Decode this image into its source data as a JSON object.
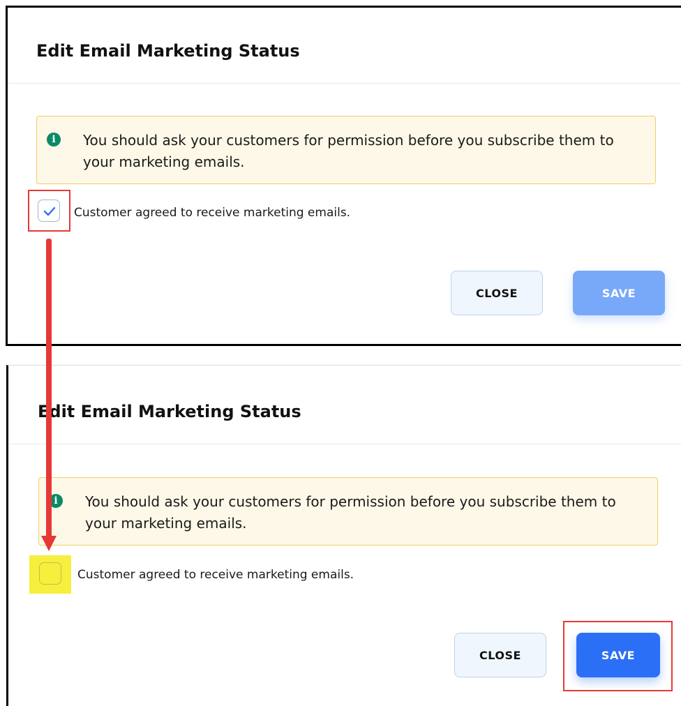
{
  "top": {
    "title": "Edit Email Marketing Status",
    "alert_text": "You should ask your customers for permission before you subscribe them to your marketing emails.",
    "checkbox_label": "Customer agreed to receive marketing emails.",
    "checkbox_checked": true,
    "close_label": "CLOSE",
    "save_label": "SAVE",
    "save_state": "disabled"
  },
  "bottom": {
    "title": "Edit Email Marketing Status",
    "alert_text": "You should ask your customers for permission before you subscribe them to your marketing emails.",
    "checkbox_label": "Customer agreed to receive marketing emails.",
    "checkbox_checked": false,
    "close_label": "CLOSE",
    "save_label": "SAVE",
    "save_state": "enabled"
  },
  "icons": {
    "info": "info-icon",
    "check": "checkmark-icon",
    "arrow": "arrow-down-annotation"
  },
  "colors": {
    "accent": "#2b6ff6",
    "accent_disabled": "#78a9f9",
    "alert_bg": "#fdf8e8",
    "alert_border": "#f1cf63",
    "info_icon": "#0b8a66",
    "annotation_red": "#e53935",
    "annotation_yellow": "#f6ef3d"
  }
}
